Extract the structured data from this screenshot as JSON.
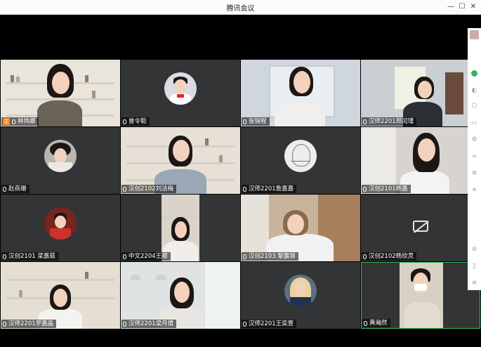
{
  "window": {
    "title": "腾讯会议"
  },
  "participants": [
    {
      "name": "林炜娜",
      "host": true
    },
    {
      "name": "曾令聪"
    },
    {
      "name": "张锦程"
    },
    {
      "name": "汉师2201郑闰瑾"
    },
    {
      "name": "赵燕珊"
    },
    {
      "name": "汉创2102刘洁梅"
    },
    {
      "name": "汉师2201詹嘉嘉"
    },
    {
      "name": "汉创2101杨嘉"
    },
    {
      "name": "汉创2101 梁嘉茹"
    },
    {
      "name": "中文2204王顺"
    },
    {
      "name": "汉创2103 黎露慧"
    },
    {
      "name": "汉创2102杨欣灵",
      "video_off": true
    },
    {
      "name": "汉师2201罗嘉晶"
    },
    {
      "name": "汉师2201梁月倩"
    },
    {
      "name": "汉师2201王奕壹"
    },
    {
      "name": "黄瀚然",
      "active_speaker": true
    }
  ],
  "colors": {
    "active_border": "#2dbb5c",
    "host_badge": "#f08a1d",
    "tile_bg": "#333436"
  },
  "sidebar_icons": [
    "avatar-icon",
    "status-dot-icon",
    "users-icon",
    "apps-icon",
    "folder-icon",
    "settings-icon",
    "link-icon",
    "gear-icon",
    "sparkle-icon",
    "ban-icon",
    "phone-icon",
    "menu-icon"
  ]
}
